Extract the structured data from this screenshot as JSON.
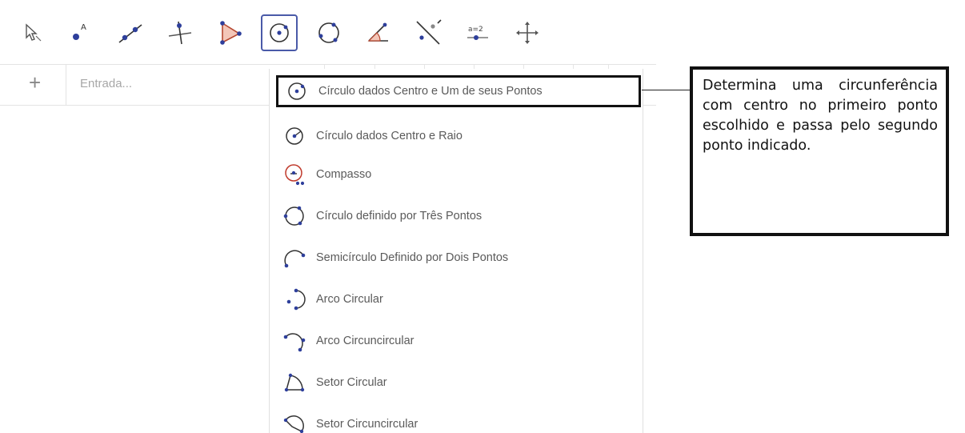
{
  "colors": {
    "active_border": "#4a5aa8",
    "menu_text": "#5a5a5a",
    "point_blue": "#2e3f9b",
    "accent_red": "#c0392b",
    "callout_border": "#111111"
  },
  "toolbar": {
    "tools": [
      {
        "name": "move-icon"
      },
      {
        "name": "point-icon"
      },
      {
        "name": "line-icon"
      },
      {
        "name": "perpendicular-line-icon"
      },
      {
        "name": "polygon-icon"
      },
      {
        "name": "circle-center-point-icon",
        "active": true
      },
      {
        "name": "circle-three-points-icon"
      },
      {
        "name": "angle-icon"
      },
      {
        "name": "reflect-icon"
      },
      {
        "name": "slider-icon"
      },
      {
        "name": "move-graphics-view-icon"
      }
    ]
  },
  "algebra": {
    "plus": "+",
    "input_placeholder": "Entrada..."
  },
  "menu": {
    "items": [
      {
        "label": "Círculo dados Centro e Um de seus Pontos",
        "icon": "circle-center-point-icon",
        "selected": true
      },
      {
        "label": "Círculo dados Centro e Raio",
        "icon": "circle-center-radius-icon"
      },
      {
        "label": "Compasso",
        "icon": "compass-icon"
      },
      {
        "label": "Círculo definido por Três Pontos",
        "icon": "circle-three-points-icon"
      },
      {
        "label": "Semicírculo Definido por Dois Pontos",
        "icon": "semicircle-icon"
      },
      {
        "label": "Arco Circular",
        "icon": "circular-arc-icon"
      },
      {
        "label": "Arco Circuncircular",
        "icon": "circumcircular-arc-icon"
      },
      {
        "label": "Setor Circular",
        "icon": "circular-sector-icon"
      },
      {
        "label": "Setor Circuncircular",
        "icon": "circumcircular-sector-icon"
      }
    ]
  },
  "callout": {
    "text": "Determina uma circunferência com centro no primeiro ponto escolhido e passa pelo segundo ponto indicado."
  }
}
